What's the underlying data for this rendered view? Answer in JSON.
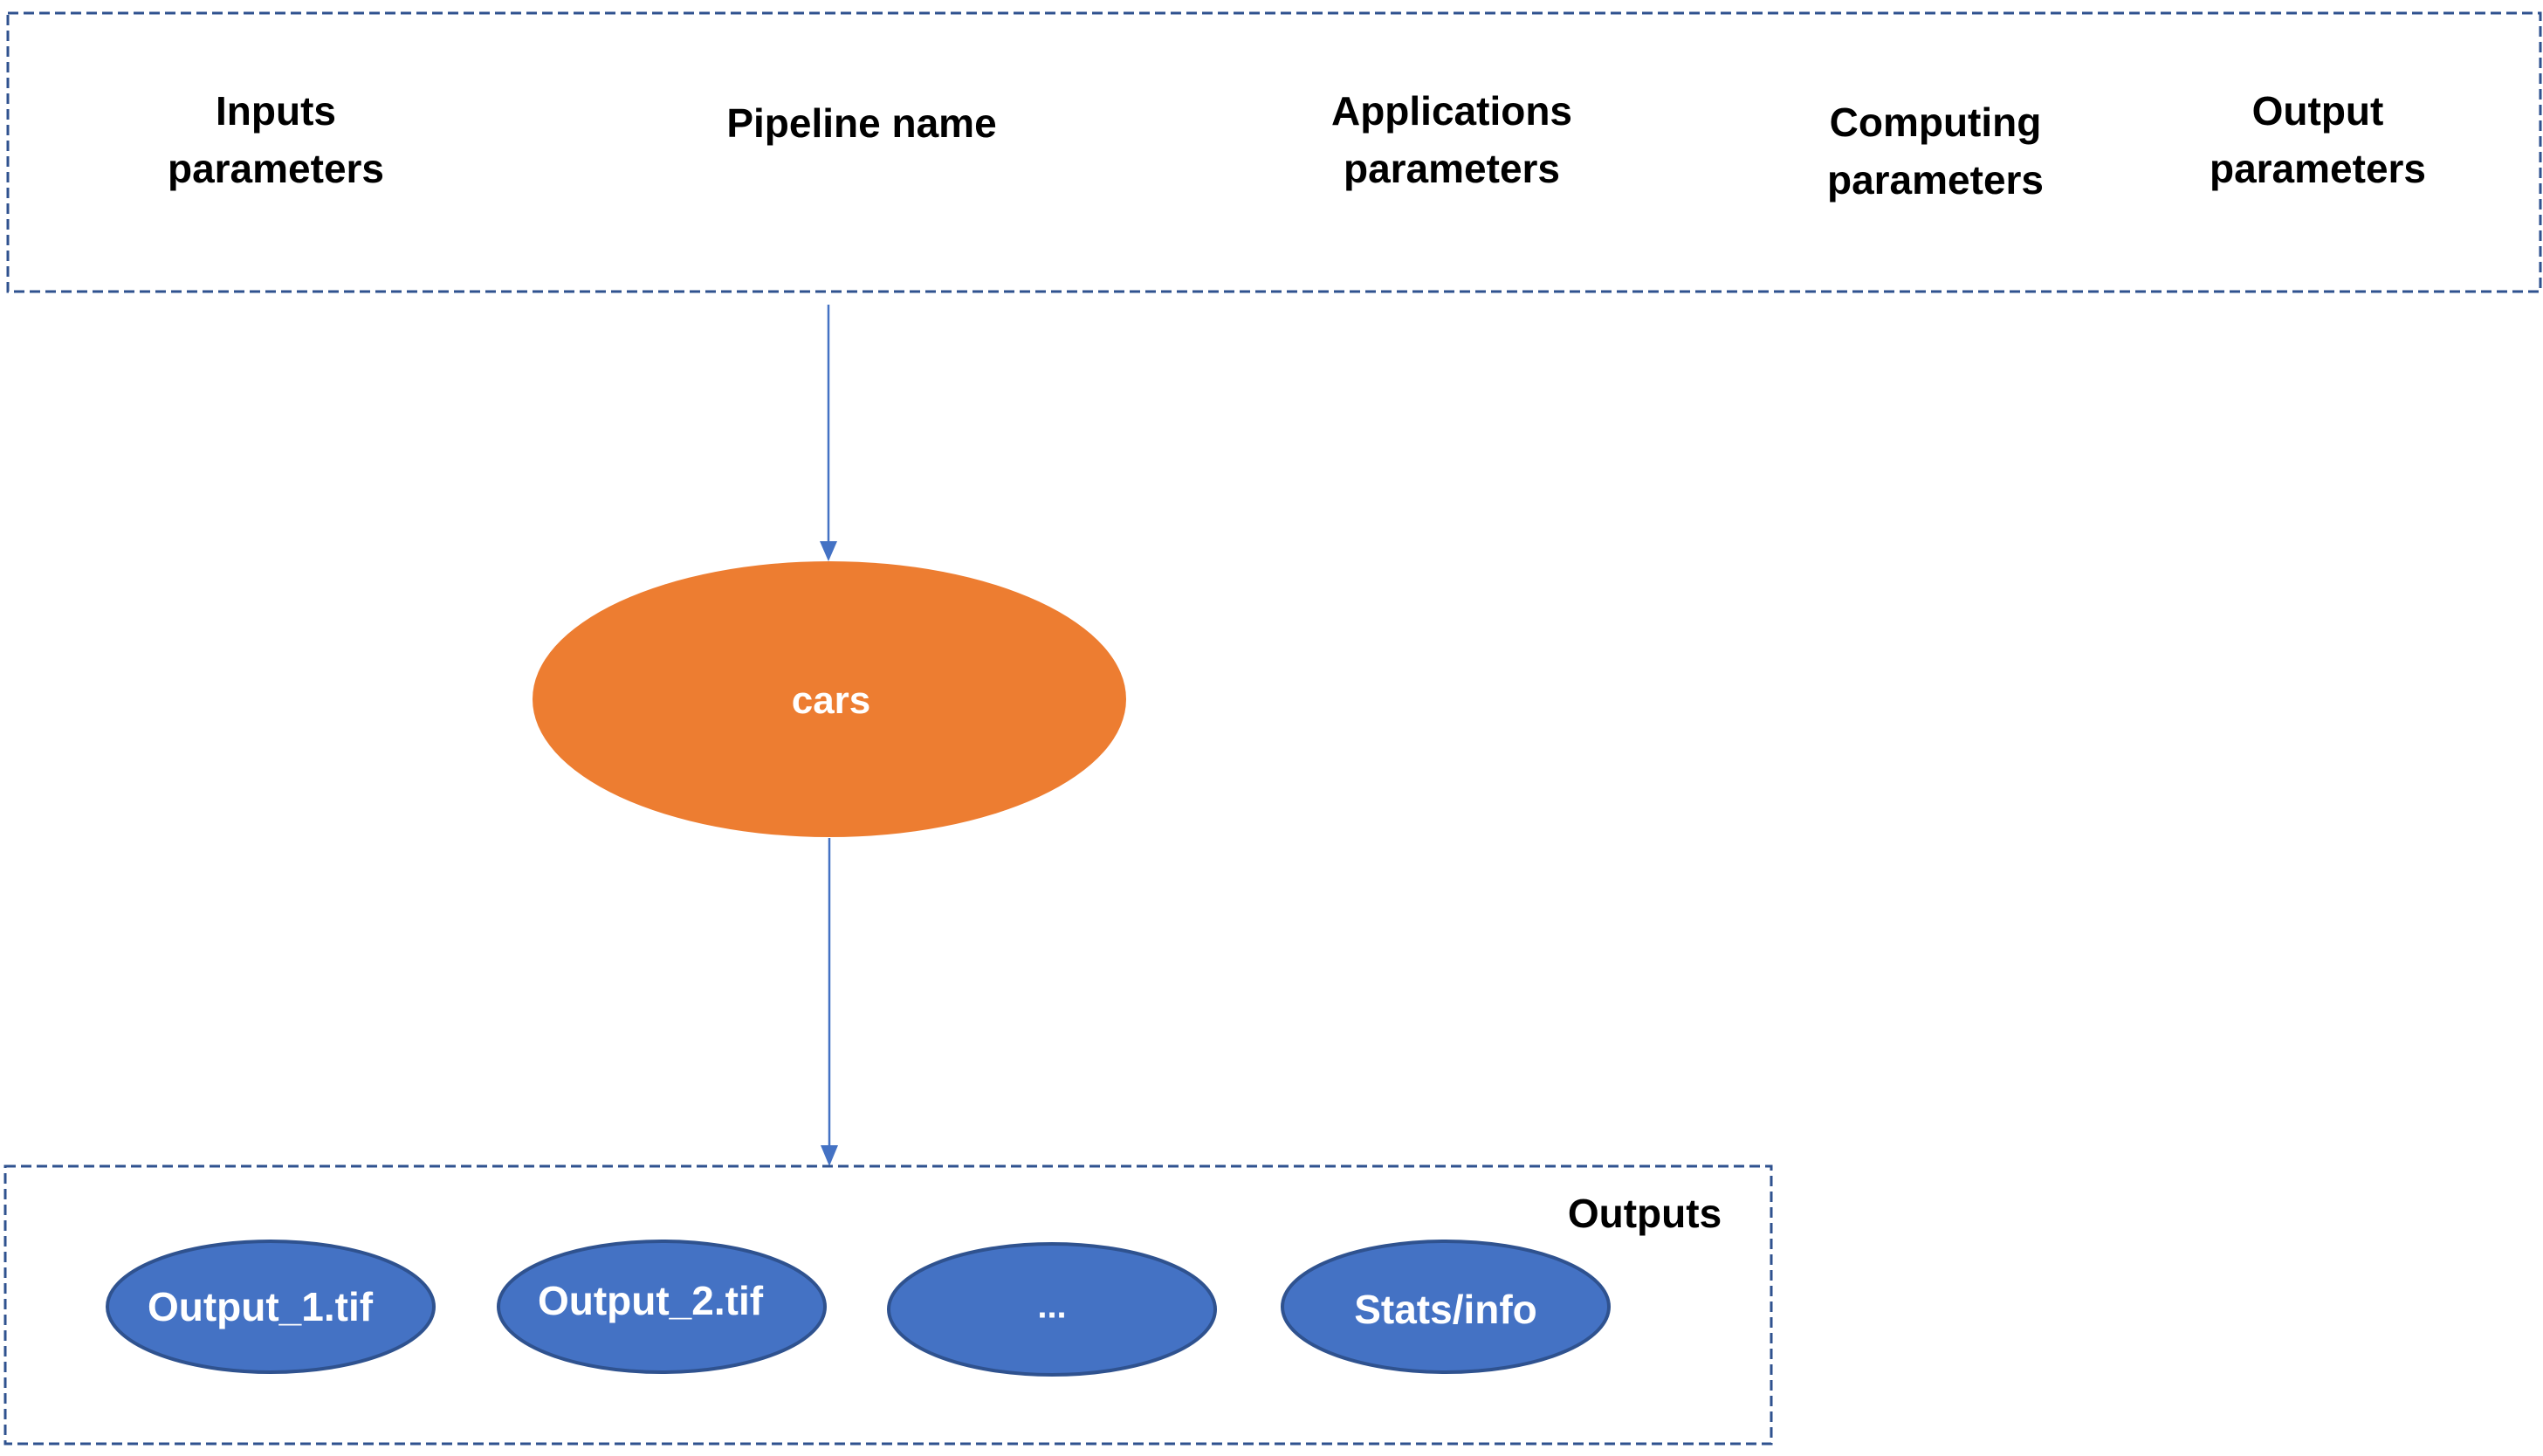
{
  "parameters": [
    {
      "label": "Inputs\nparameters"
    },
    {
      "label": "Pipeline name"
    },
    {
      "label": "Applications\nparameters"
    },
    {
      "label": "Computing\nparameters"
    },
    {
      "label": "Output\nparameters"
    }
  ],
  "pipeline": {
    "label": "cars",
    "color": "#ED7D31"
  },
  "outputs": {
    "title": "Outputs",
    "color": "#4472C4",
    "items": [
      {
        "label": "Output_1.tif"
      },
      {
        "label": "Output_2.tif"
      },
      {
        "label": "..."
      },
      {
        "label": "Stats/info"
      }
    ]
  },
  "colors": {
    "border": "#2F528F",
    "arrow": "#4472C4"
  }
}
